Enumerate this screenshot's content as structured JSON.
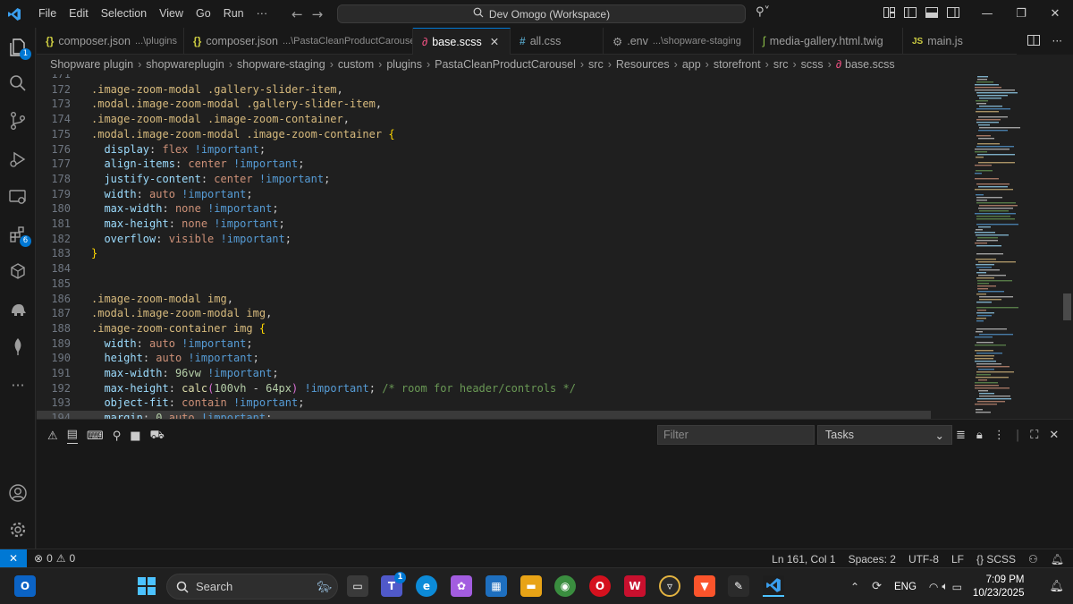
{
  "titlebar": {
    "menu": [
      "File",
      "Edit",
      "Selection",
      "View",
      "Go",
      "Run",
      "···"
    ],
    "command_center": "Dev Omogo (Workspace)"
  },
  "activity": {
    "explorer_badge": "1",
    "extensions_badge": "6"
  },
  "tabs": [
    {
      "icon": "{}",
      "label": "composer.json",
      "desc": "...\\plugins",
      "active": false
    },
    {
      "icon": "{}",
      "label": "composer.json",
      "desc": "...\\PastaCleanProductCarousel",
      "active": false
    },
    {
      "icon": "sass",
      "label": "base.scss",
      "desc": "",
      "active": true
    },
    {
      "icon": "#",
      "label": "all.css",
      "desc": "",
      "active": false
    },
    {
      "icon": "gear",
      "label": ".env",
      "desc": "...\\shopware-staging",
      "active": false
    },
    {
      "icon": "twig",
      "label": "media-gallery.html.twig",
      "desc": "",
      "active": false
    },
    {
      "icon": "JS",
      "label": "main.js",
      "desc": "",
      "active": false
    }
  ],
  "breadcrumb": [
    "Shopware plugin",
    "shopwareplugin",
    "shopware-staging",
    "custom",
    "plugins",
    "PastaCleanProductCarousel",
    "src",
    "Resources",
    "app",
    "storefront",
    "src",
    "scss",
    "base.scss"
  ],
  "editor": {
    "lines": [
      {
        "n": "171",
        "segs": []
      },
      {
        "n": "172",
        "segs": [
          [
            "sel",
            ".image-zoom-modal .gallery-slider-item"
          ],
          [
            "pun",
            ","
          ]
        ]
      },
      {
        "n": "173",
        "segs": [
          [
            "sel",
            ".modal.image-zoom-modal .gallery-slider-item"
          ],
          [
            "pun",
            ","
          ]
        ]
      },
      {
        "n": "174",
        "segs": [
          [
            "sel",
            ".image-zoom-modal .image-zoom-container"
          ],
          [
            "pun",
            ","
          ]
        ]
      },
      {
        "n": "175",
        "segs": [
          [
            "sel",
            ".modal.image-zoom-modal .image-zoom-container "
          ],
          [
            "brace",
            "{"
          ]
        ]
      },
      {
        "n": "176",
        "segs": [
          [
            "pun",
            "  "
          ],
          [
            "prop",
            "display"
          ],
          [
            "pun",
            ": "
          ],
          [
            "val",
            "flex "
          ],
          [
            "imp",
            "!important"
          ],
          [
            "pun",
            ";"
          ]
        ]
      },
      {
        "n": "177",
        "segs": [
          [
            "pun",
            "  "
          ],
          [
            "prop",
            "align-items"
          ],
          [
            "pun",
            ": "
          ],
          [
            "val",
            "center "
          ],
          [
            "imp",
            "!important"
          ],
          [
            "pun",
            ";"
          ]
        ]
      },
      {
        "n": "178",
        "segs": [
          [
            "pun",
            "  "
          ],
          [
            "prop",
            "justify-content"
          ],
          [
            "pun",
            ": "
          ],
          [
            "val",
            "center "
          ],
          [
            "imp",
            "!important"
          ],
          [
            "pun",
            ";"
          ]
        ]
      },
      {
        "n": "179",
        "segs": [
          [
            "pun",
            "  "
          ],
          [
            "prop",
            "width"
          ],
          [
            "pun",
            ": "
          ],
          [
            "val",
            "auto "
          ],
          [
            "imp",
            "!important"
          ],
          [
            "pun",
            ";"
          ]
        ]
      },
      {
        "n": "180",
        "segs": [
          [
            "pun",
            "  "
          ],
          [
            "prop",
            "max-width"
          ],
          [
            "pun",
            ": "
          ],
          [
            "val",
            "none "
          ],
          [
            "imp",
            "!important"
          ],
          [
            "pun",
            ";"
          ]
        ]
      },
      {
        "n": "181",
        "segs": [
          [
            "pun",
            "  "
          ],
          [
            "prop",
            "max-height"
          ],
          [
            "pun",
            ": "
          ],
          [
            "val",
            "none "
          ],
          [
            "imp",
            "!important"
          ],
          [
            "pun",
            ";"
          ]
        ]
      },
      {
        "n": "182",
        "segs": [
          [
            "pun",
            "  "
          ],
          [
            "prop",
            "overflow"
          ],
          [
            "pun",
            ": "
          ],
          [
            "val",
            "visible "
          ],
          [
            "imp",
            "!important"
          ],
          [
            "pun",
            ";"
          ]
        ]
      },
      {
        "n": "183",
        "segs": [
          [
            "brace",
            "}"
          ]
        ]
      },
      {
        "n": "184",
        "segs": []
      },
      {
        "n": "185",
        "segs": []
      },
      {
        "n": "186",
        "segs": [
          [
            "sel",
            ".image-zoom-modal img"
          ],
          [
            "pun",
            ","
          ]
        ]
      },
      {
        "n": "187",
        "segs": [
          [
            "sel",
            ".modal.image-zoom-modal img"
          ],
          [
            "pun",
            ","
          ]
        ]
      },
      {
        "n": "188",
        "segs": [
          [
            "sel",
            ".image-zoom-container img "
          ],
          [
            "brace",
            "{"
          ]
        ]
      },
      {
        "n": "189",
        "segs": [
          [
            "pun",
            "  "
          ],
          [
            "prop",
            "width"
          ],
          [
            "pun",
            ": "
          ],
          [
            "val",
            "auto "
          ],
          [
            "imp",
            "!important"
          ],
          [
            "pun",
            ";"
          ]
        ]
      },
      {
        "n": "190",
        "segs": [
          [
            "pun",
            "  "
          ],
          [
            "prop",
            "height"
          ],
          [
            "pun",
            ": "
          ],
          [
            "val",
            "auto "
          ],
          [
            "imp",
            "!important"
          ],
          [
            "pun",
            ";"
          ]
        ]
      },
      {
        "n": "191",
        "segs": [
          [
            "pun",
            "  "
          ],
          [
            "prop",
            "max-width"
          ],
          [
            "pun",
            ": "
          ],
          [
            "num",
            "96vw "
          ],
          [
            "imp",
            "!important"
          ],
          [
            "pun",
            ";"
          ]
        ]
      },
      {
        "n": "192",
        "segs": [
          [
            "pun",
            "  "
          ],
          [
            "prop",
            "max-height"
          ],
          [
            "pun",
            ": "
          ],
          [
            "fn",
            "calc"
          ],
          [
            "paren",
            "("
          ],
          [
            "num",
            "100vh"
          ],
          [
            "pun",
            " - "
          ],
          [
            "num",
            "64px"
          ],
          [
            "paren",
            ")"
          ],
          [
            "pun",
            " "
          ],
          [
            "imp",
            "!important"
          ],
          [
            "pun",
            "; "
          ],
          [
            "cmt",
            "/* room for header/controls */"
          ]
        ]
      },
      {
        "n": "193",
        "segs": [
          [
            "pun",
            "  "
          ],
          [
            "prop",
            "object-fit"
          ],
          [
            "pun",
            ": "
          ],
          [
            "val",
            "contain "
          ],
          [
            "imp",
            "!important"
          ],
          [
            "pun",
            ";"
          ]
        ]
      },
      {
        "n": "194",
        "segs": [
          [
            "pun",
            "  "
          ],
          [
            "prop",
            "margin"
          ],
          [
            "pun",
            ": "
          ],
          [
            "num",
            "0 "
          ],
          [
            "val",
            "auto "
          ],
          [
            "imp",
            "!important"
          ],
          [
            "pun",
            ";"
          ]
        ]
      }
    ]
  },
  "panel": {
    "filter_placeholder": "Filter",
    "tasks_label": "Tasks"
  },
  "status": {
    "problems": "0",
    "warnings": "0",
    "position": "Ln 161, Col 1",
    "spaces": "Spaces: 2",
    "encoding": "UTF-8",
    "eol": "LF",
    "language": "SCSS"
  },
  "taskbar": {
    "search_label": "Search",
    "teams_badge": "1",
    "lang": "ENG",
    "time": "7:09 PM",
    "date": "10/23/2025"
  },
  "colors": {
    "accent": "#0078d4",
    "selector": "#d7ba7d",
    "property": "#9cdcfe",
    "value": "#ce9178",
    "keyword": "#569cd6",
    "number": "#b5cea8",
    "comment": "#6a9955"
  }
}
